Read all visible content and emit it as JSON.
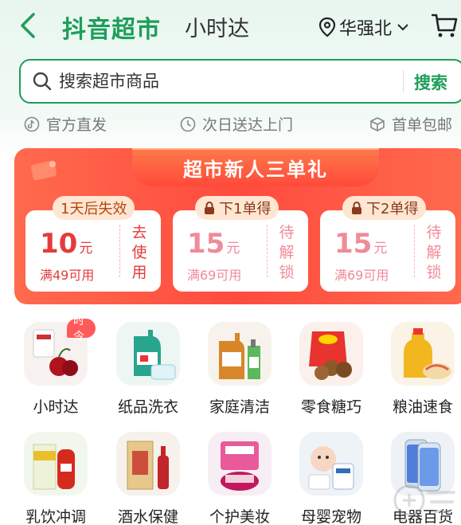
{
  "header": {
    "brand": "抖音超市",
    "subbrand": "小时达",
    "location": "华强北",
    "colors": {
      "brand": "#1e9e5a"
    }
  },
  "search": {
    "placeholder": "搜索超市商品",
    "button_label": "搜索"
  },
  "features": [
    {
      "icon": "tiktok-icon",
      "label": "官方直发"
    },
    {
      "icon": "clock-icon",
      "label": "次日送达上门"
    },
    {
      "icon": "package-icon",
      "label": "首单包邮"
    }
  ],
  "promo": {
    "title": "超市新人三单礼",
    "coupons": [
      {
        "tag": "1天后失效",
        "locked": false,
        "amount": "10",
        "unit": "元",
        "condition": "满49可用",
        "action": "去使用"
      },
      {
        "tag": "下1单得",
        "locked": true,
        "amount": "15",
        "unit": "元",
        "condition": "满69可用",
        "action": "待解锁"
      },
      {
        "tag": "下2单得",
        "locked": true,
        "amount": "15",
        "unit": "元",
        "condition": "满69可用",
        "action": "待解锁"
      }
    ]
  },
  "categories": [
    {
      "label": "小时达",
      "badge": "时令"
    },
    {
      "label": "纸品洗衣"
    },
    {
      "label": "家庭清洁"
    },
    {
      "label": "零食糖巧"
    },
    {
      "label": "粮油速食"
    },
    {
      "label": "乳饮冲调"
    },
    {
      "label": "酒水保健"
    },
    {
      "label": "个护美妆"
    },
    {
      "label": "母婴宠物"
    },
    {
      "label": "电器百货"
    }
  ]
}
